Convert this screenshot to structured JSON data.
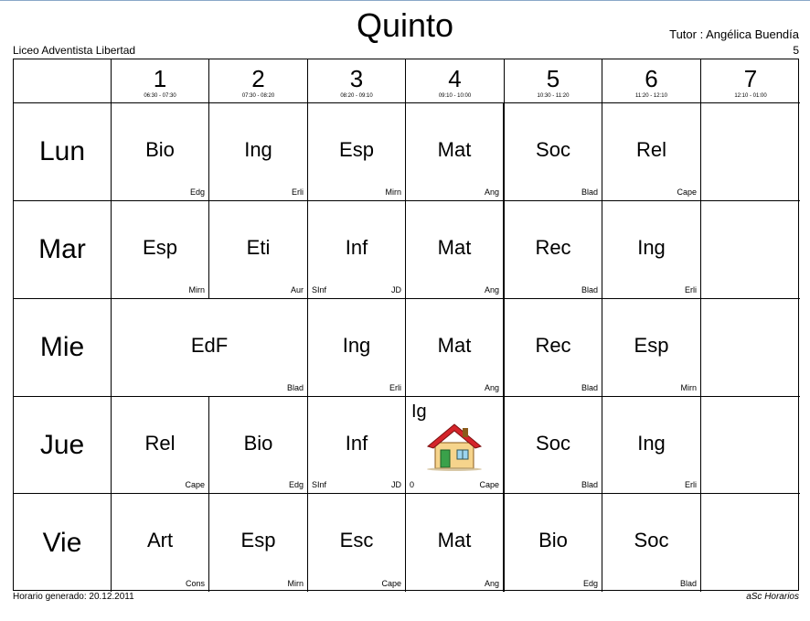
{
  "header": {
    "title": "Quinto",
    "tutor": "Tutor : Angélica Buendía",
    "group": "5",
    "school": "Liceo Adventista Libertad"
  },
  "footer": {
    "left": "Horario generado: 20.12.2011",
    "right": "aSc Horarios"
  },
  "periods": [
    {
      "num": "1",
      "time": "06:30 - 07:30"
    },
    {
      "num": "2",
      "time": "07:30 - 08:20"
    },
    {
      "num": "3",
      "time": "08:20 - 09:10"
    },
    {
      "num": "4",
      "time": "09:10 - 10:00"
    },
    {
      "num": "5",
      "time": "10:30 - 11:20"
    },
    {
      "num": "6",
      "time": "11:20 - 12:10"
    },
    {
      "num": "7",
      "time": "12:10 - 01:00"
    }
  ],
  "days": [
    "Lun",
    "Mar",
    "Mie",
    "Jue",
    "Vie"
  ],
  "lessons": [
    [
      {
        "subject": "Bio",
        "teacher": "Edg"
      },
      {
        "subject": "Ing",
        "teacher": "Erli"
      },
      {
        "subject": "Esp",
        "teacher": "Mirn"
      },
      {
        "subject": "Mat",
        "teacher": "Ang"
      },
      {
        "subject": "Soc",
        "teacher": "Blad"
      },
      {
        "subject": "Rel",
        "teacher": "Cape"
      },
      null
    ],
    [
      {
        "subject": "Esp",
        "teacher": "Mirn"
      },
      {
        "subject": "Eti",
        "teacher": "Aur"
      },
      {
        "subject": "Inf",
        "teacher": "JD",
        "room": "SInf"
      },
      {
        "subject": "Mat",
        "teacher": "Ang"
      },
      {
        "subject": "Rec",
        "teacher": "Blad"
      },
      {
        "subject": "Ing",
        "teacher": "Erli"
      },
      null
    ],
    [
      {
        "subject": "EdF",
        "teacher": "Blad",
        "span": 2
      },
      {
        "subject": "Ing",
        "teacher": "Erli"
      },
      {
        "subject": "Mat",
        "teacher": "Ang"
      },
      {
        "subject": "Rec",
        "teacher": "Blad"
      },
      {
        "subject": "Esp",
        "teacher": "Mirn"
      },
      null
    ],
    [
      {
        "subject": "Rel",
        "teacher": "Cape"
      },
      {
        "subject": "Bio",
        "teacher": "Edg"
      },
      {
        "subject": "Inf",
        "teacher": "JD",
        "room": "SInf"
      },
      {
        "subject": "Ig",
        "teacher": "Cape",
        "room": "0",
        "icon": "house-icon"
      },
      {
        "subject": "Soc",
        "teacher": "Blad"
      },
      {
        "subject": "Ing",
        "teacher": "Erli"
      },
      null
    ],
    [
      {
        "subject": "Art",
        "teacher": "Cons"
      },
      {
        "subject": "Esp",
        "teacher": "Mirn"
      },
      {
        "subject": "Esc",
        "teacher": "Cape"
      },
      {
        "subject": "Mat",
        "teacher": "Ang"
      },
      {
        "subject": "Bio",
        "teacher": "Edg"
      },
      {
        "subject": "Soc",
        "teacher": "Blad"
      },
      null
    ]
  ],
  "colors": {
    "gridline": "#000000",
    "house_roof": "#d4242a",
    "house_wall": "#f6d48c",
    "house_door": "#3aa14a"
  }
}
